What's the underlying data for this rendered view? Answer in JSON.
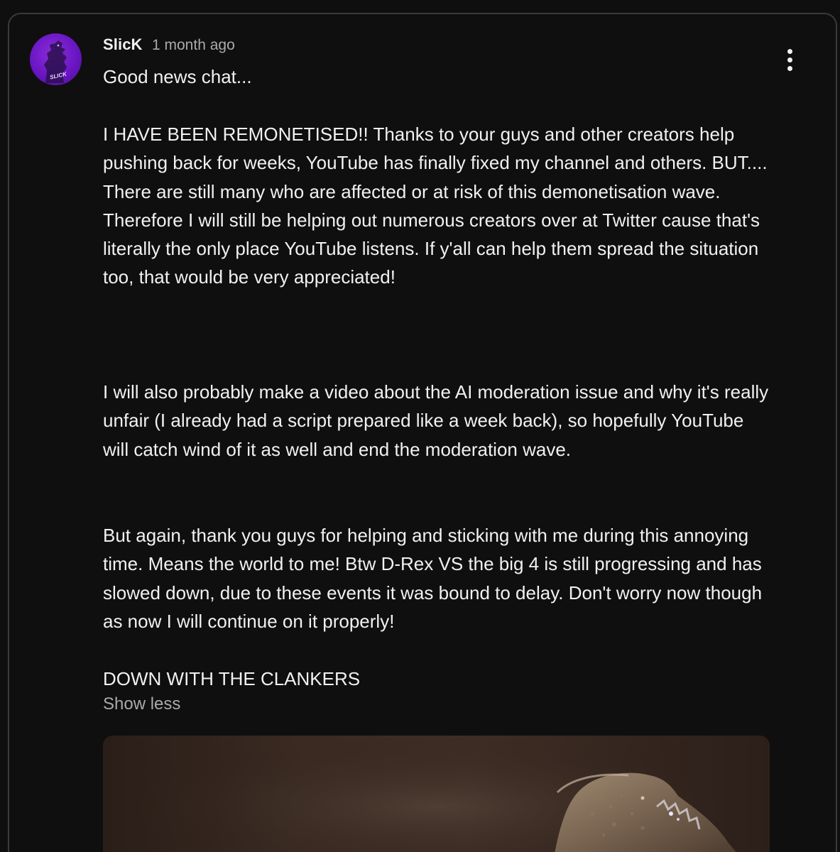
{
  "post": {
    "author": "SlicK",
    "timestamp": "1 month ago",
    "avatar_text": "SLICK",
    "paragraphs": [
      "Good news chat...",
      "I HAVE BEEN REMONETISED!! Thanks to your guys and other creators help pushing back for weeks, YouTube has finally fixed my channel and others. BUT.... There are still many who are affected or at risk of this demonetisation wave. Therefore I will still be helping out numerous creators over at Twitter cause that's literally the only place YouTube listens. If y'all can help them spread the situation too, that would be very appreciated!",
      "I will also probably make a video about the AI moderation issue and why it's really unfair (I already had a script prepared like a week back), so hopefully YouTube will catch wind of it as well and end the moderation wave.",
      "But again, thank you guys for helping and sticking with me during this annoying time. Means the world to me! Btw D-Rex VS the big 4 is still progressing and has slowed down, due to these events it was bound to delay. Don't worry now though as now I will continue on it properly!",
      "DOWN WITH THE CLANKERS"
    ],
    "show_less_label": "Show less",
    "menu_icon": "more-vert-icon",
    "media_subject": "reptile-creature-image"
  },
  "colors": {
    "background": "#0f0f0f",
    "text_primary": "#f1f1f1",
    "text_secondary": "#aaaaaa",
    "avatar_purple": "#6a16c4"
  }
}
